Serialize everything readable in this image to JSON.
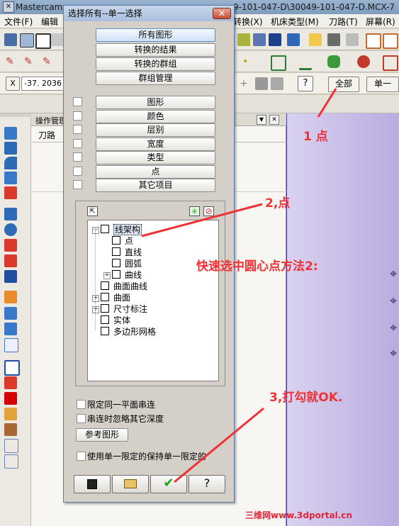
{
  "window": {
    "title_left": "Mastercam",
    "title_right": "9-101-047-D\\30049-101-047-D.MCX-7"
  },
  "menubar": {
    "items": [
      "文件(F)",
      "编辑",
      "转换(X)",
      "机床类型(M)",
      "刀路(T)",
      "屏幕(R)"
    ]
  },
  "toolbar3": {
    "x_label": "X",
    "x_value": "-37. 2036",
    "all_button": "全部",
    "single_button": "单一"
  },
  "ops_manager": {
    "title": "操作管理",
    "tab": "刀路"
  },
  "dialog": {
    "title": "选择所有--单一选择",
    "close_symbol": "✕",
    "buttons_top": [
      "所有图形",
      "转换的结果",
      "转换的群组",
      "群组管理"
    ],
    "filter_buttons": [
      "图形",
      "颜色",
      "层别",
      "宽度",
      "类型",
      "点",
      "其它项目"
    ],
    "tree": [
      {
        "label": "线架构",
        "level": 0,
        "expander": "−",
        "selected": true
      },
      {
        "label": "点",
        "level": 1
      },
      {
        "label": "直线",
        "level": 1
      },
      {
        "label": "圆弧",
        "level": 1
      },
      {
        "label": "曲线",
        "level": 1,
        "expander": "+"
      },
      {
        "label": "曲面曲线",
        "level": 0
      },
      {
        "label": "曲面",
        "level": 0,
        "expander": "+"
      },
      {
        "label": "尺寸标注",
        "level": 0,
        "expander": "+"
      },
      {
        "label": "实体",
        "level": 0
      },
      {
        "label": "多边形网格",
        "level": 0
      }
    ],
    "option1": "限定同一平面串连",
    "option2": "串连时忽略其它深度",
    "ref_button": "参考图形",
    "option3": "使用单一限定的保持单一限定的",
    "bottom_icons": [
      "save-icon",
      "open-folder-icon",
      "ok-check-icon",
      "help-icon"
    ]
  },
  "annotations": {
    "a1": "1 点",
    "a2": "2,点",
    "a3": "快速选中圆心点方法2:",
    "a4": "3,打勾就OK.",
    "watermark": "三维网www.3dportal.cn"
  },
  "colors": {
    "annotation": "#f03237",
    "graphics_bg": "#c3b8e6"
  }
}
